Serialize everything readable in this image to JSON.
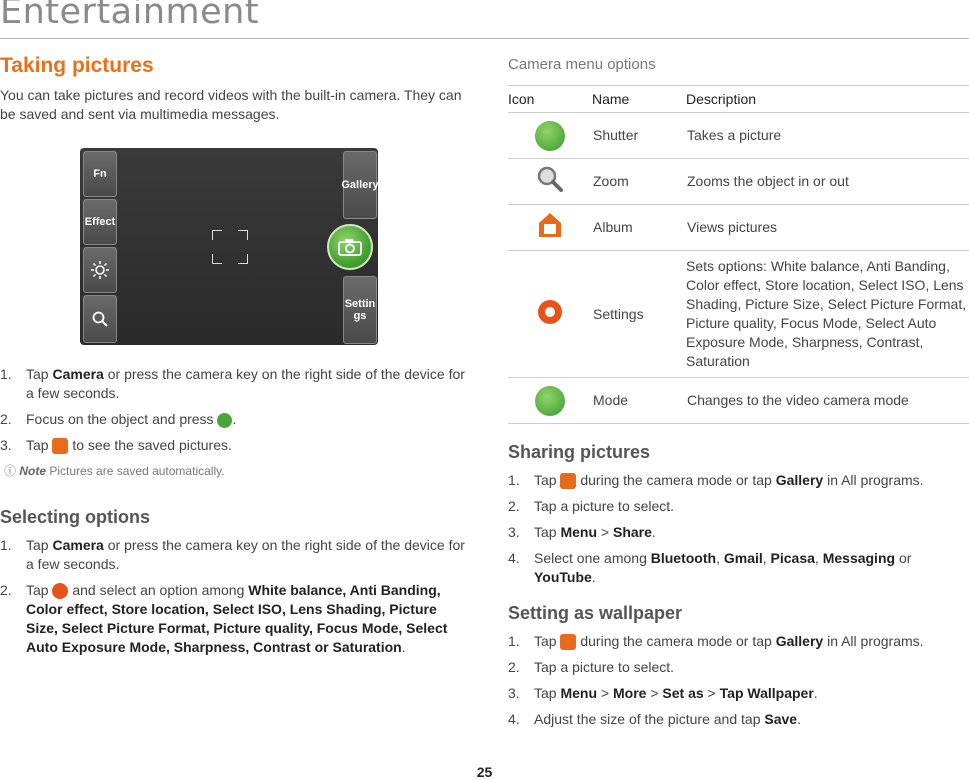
{
  "chapter": {
    "title": "Entertainment"
  },
  "taking": {
    "heading": "Taking pictures",
    "intro": "You can take pictures and record videos with the built-in camera. They can be saved and sent via multimedia messages.",
    "preview": {
      "fn": "Fn",
      "effect": "Effect",
      "gallery": "Gallery",
      "settings": "Settin gs"
    },
    "steps": [
      {
        "num": "1.",
        "pre": "Tap ",
        "kw": "Camera",
        "post": " or press the camera key on the right side of the device for a few seconds."
      },
      {
        "num": "2.",
        "pre": "Focus on the object and press ",
        "post": "."
      },
      {
        "num": "3.",
        "pre": "Tap ",
        "post": " to see the saved pictures."
      }
    ],
    "note": {
      "word": "Note",
      "text": " Pictures are saved automatically."
    }
  },
  "selecting": {
    "heading": "Selecting options",
    "steps": [
      {
        "num": "1.",
        "pre": "Tap ",
        "kw": "Camera",
        "post": " or press the camera key on the right side of the device for a few seconds."
      },
      {
        "num": "2.",
        "pre": "Tap ",
        "mid": " and select an option among ",
        "kw": "White balance, Anti Banding, Color effect, Store location, Select ISO, Lens Shading, Picture Size, Select Picture Format, Picture quality, Focus Mode, Select Auto Exposure Mode, Sharpness, Contrast or Saturation",
        "post": "."
      }
    ]
  },
  "camera_menu": {
    "caption": "Camera menu options",
    "headers": {
      "icon": "Icon",
      "name": "Name",
      "description": "Description"
    },
    "rows": [
      {
        "icon": "shutter-icon",
        "name": "Shutter",
        "description": "Takes a picture"
      },
      {
        "icon": "zoom-icon",
        "name": "Zoom",
        "description": "Zooms the object in or out"
      },
      {
        "icon": "album-icon",
        "name": "Album",
        "description": "Views pictures"
      },
      {
        "icon": "settings-icon",
        "name": "Settings",
        "description": "Sets options: White balance, Anti Banding, Color effect, Store location, Select ISO, Lens Shading, Picture Size, Select Picture Format, Picture quality, Focus Mode, Select Auto Exposure Mode, Sharpness, Contrast, Saturation"
      },
      {
        "icon": "video-mode-icon",
        "name": "Mode",
        "description": "Changes to the video camera mode"
      }
    ]
  },
  "sharing": {
    "heading": "Sharing pictures",
    "s1": {
      "num": "1.",
      "pre": "Tap ",
      "mid": " during the camera mode or tap ",
      "kw": "Gallery",
      "post": " in All programs."
    },
    "s2": {
      "num": "2.",
      "text": "Tap a picture to select."
    },
    "s3": {
      "num": "3.",
      "pre": "Tap ",
      "kw1": "Menu",
      "sep": " > ",
      "kw2": "Share",
      "post": "."
    },
    "s4": {
      "num": "4.",
      "pre": "Select one among ",
      "kw1": "Bluetooth",
      "c1": ", ",
      "kw2": "Gmail",
      "c2": ", ",
      "kw3": "Picasa",
      "c3": ", ",
      "kw4": "Messaging",
      "or": " or ",
      "kw5": "YouTube",
      "post": "."
    }
  },
  "wallpaper": {
    "heading": "Setting as wallpaper",
    "s1": {
      "num": "1.",
      "pre": "Tap ",
      "mid": " during the camera mode or tap ",
      "kw": "Gallery",
      "post": " in All programs."
    },
    "s2": {
      "num": "2.",
      "text": "Tap a picture to select."
    },
    "s3": {
      "num": "3.",
      "pre": "Tap ",
      "kw1": "Menu",
      "sep1": " > ",
      "kw2": "More",
      "sep2": " > ",
      "kw3": "Set as",
      "sep3": " > ",
      "kw4": "Tap Wallpaper",
      "post": "."
    },
    "s4": {
      "num": "4.",
      "pre": "Adjust the size of the picture and tap ",
      "kw": "Save",
      "post": "."
    }
  },
  "page": {
    "number": "25"
  },
  "colors": {
    "accent": "#e8711c",
    "shutter_green": "#4aa63a",
    "album_orange": "#e86a1c",
    "settings_orange": "#e8521c"
  }
}
